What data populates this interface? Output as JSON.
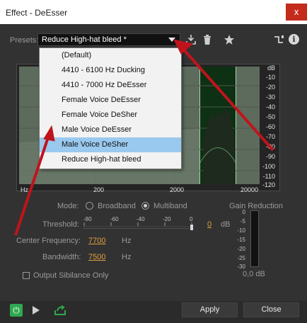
{
  "window": {
    "title": "Effect - DeEsser",
    "close_label": "x"
  },
  "presets": {
    "label": "Presets:",
    "selected": "Reduce High-hat bleed *",
    "options": [
      "(Default)",
      "4410 - 6100 Hz Ducking",
      "4410 - 7000 Hz DeEsser",
      "Female Voice DeEsser",
      "Female Voice DeSher",
      "Male Voice DeEsser",
      "Male Voice DeSher",
      "Reduce High-hat bleed"
    ],
    "highlighted_index": 6
  },
  "toolbar_icons": {
    "download": "download-icon",
    "delete": "trash-icon",
    "favorite": "star-icon",
    "routing": "routing-icon",
    "info": "info-icon",
    "info_glyph": "i"
  },
  "graph": {
    "db_labels": [
      "dB",
      "-10",
      "-20",
      "-30",
      "-40",
      "-50",
      "-60",
      "-70",
      "-80",
      "-90",
      "-100",
      "-110",
      "-120"
    ],
    "hz_labels": [
      "Hz",
      "200",
      "2000",
      "20000"
    ]
  },
  "mode": {
    "label": "Mode:",
    "options": [
      "Broadband",
      "Multiband"
    ],
    "selected": "Multiband"
  },
  "threshold": {
    "label": "Threshold:",
    "ticks": [
      "-80",
      "-60",
      "-40",
      "-20",
      "0"
    ],
    "value": "0",
    "unit": "dB",
    "level_fraction": 1.0
  },
  "center_frequency": {
    "label": "Center Frequency:",
    "value": "7700",
    "unit": "Hz"
  },
  "bandwidth": {
    "label": "Bandwidth:",
    "value": "7500",
    "unit": "Hz"
  },
  "output_sibilance": {
    "label": "Output Sibilance Only",
    "checked": false
  },
  "gain_reduction": {
    "label": "Gain Reduction",
    "ticks": [
      "0",
      "-5",
      "-10",
      "-15",
      "-20",
      "-25",
      "-30"
    ],
    "readout": "0,0 dB"
  },
  "buttons": {
    "apply": "Apply",
    "close": "Close"
  },
  "colors": {
    "accent_value": "#e2a03f",
    "band": "#0e3014",
    "power": "#2fa84f",
    "arrow": "#c0141c",
    "highlight": "#99c9ef"
  }
}
